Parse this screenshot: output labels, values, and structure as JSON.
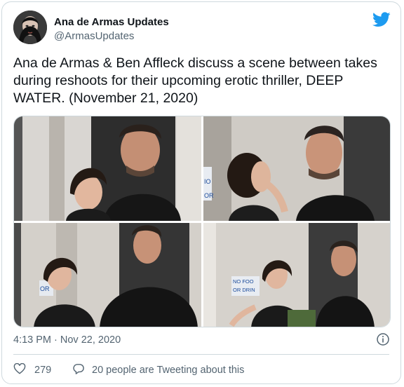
{
  "author": {
    "name": "Ana de Armas Updates",
    "handle": "@ArmasUpdates"
  },
  "tweet": {
    "text": "Ana de Armas & Ben Affleck discuss a scene between takes during reshoots for their upcoming erotic thriller, DEEP WATER. (November 21, 2020)"
  },
  "photos": [
    {
      "alt": "photo-1"
    },
    {
      "alt": "photo-2",
      "sign": [
        "IO",
        "OR"
      ]
    },
    {
      "alt": "photo-3",
      "sign": [
        "OR"
      ]
    },
    {
      "alt": "photo-4",
      "sign": [
        "NO FOO",
        "OR DRIN"
      ]
    }
  ],
  "meta": {
    "timestamp": "4:13 PM · Nov 22, 2020"
  },
  "actions": {
    "like_count": "279",
    "reply_text": "20 people are Tweeting about this"
  },
  "colors": {
    "brand": "#1d9bf0",
    "secondary_text": "#536471",
    "border": "#cfd9de"
  },
  "icons": {
    "brand": "twitter-bird-icon",
    "info": "info-icon",
    "like": "heart-icon",
    "reply": "speech-bubble-icon"
  }
}
